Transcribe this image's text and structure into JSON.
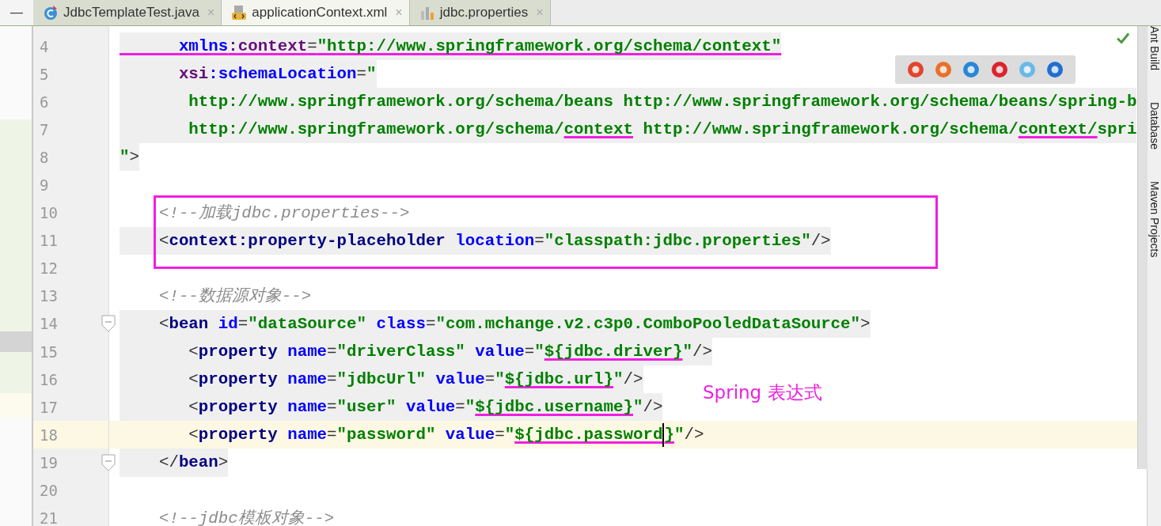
{
  "panel_button": "—",
  "tabs": [
    {
      "label": "JdbcTemplateTest.java",
      "kind": "java",
      "selected": false,
      "close": "×"
    },
    {
      "label": "applicationContext.xml",
      "kind": "xml",
      "selected": true,
      "close": "×"
    },
    {
      "label": "jdbc.properties",
      "kind": "properties",
      "selected": false,
      "close": "×"
    }
  ],
  "lines": [
    {
      "number": "4",
      "fold": false,
      "shaded": true,
      "boxed": false,
      "current": false,
      "tokens": [
        {
          "text": "      xmlns",
          "kind": "attr",
          "underlined": true
        },
        {
          "text": ":context",
          "kind": "ns",
          "underlined": true
        },
        {
          "text": "=",
          "kind": "punct",
          "underlined": true
        },
        {
          "text": "\"http://www.springframework.org/schema/context\"",
          "kind": "value",
          "underlined": true
        }
      ]
    },
    {
      "number": "5",
      "fold": false,
      "shaded": true,
      "boxed": false,
      "current": false,
      "tokens": [
        {
          "text": "      xsi",
          "kind": "ns",
          "underlined": false
        },
        {
          "text": ":schemaLocation",
          "kind": "attr",
          "underlined": false
        },
        {
          "text": "=",
          "kind": "punct",
          "underlined": false
        },
        {
          "text": "\"",
          "kind": "value",
          "underlined": false
        }
      ]
    },
    {
      "number": "6",
      "fold": false,
      "shaded": true,
      "boxed": false,
      "current": false,
      "tokens": [
        {
          "text": "       http://www.springframework.org/schema/beans http://www.springframework.org/schema/beans/spring-b",
          "kind": "value",
          "underlined": false
        }
      ]
    },
    {
      "number": "7",
      "fold": false,
      "shaded": true,
      "boxed": false,
      "current": false,
      "tokens": [
        {
          "text": "       http://www.springframework.org/schema/",
          "kind": "value",
          "underlined": false
        },
        {
          "text": "context",
          "kind": "value",
          "underlined": true
        },
        {
          "text": " http://www.springframework.org/schema/",
          "kind": "value",
          "underlined": false
        },
        {
          "text": "context/",
          "kind": "value",
          "underlined": true
        },
        {
          "text": "spri",
          "kind": "value",
          "underlined": false
        }
      ]
    },
    {
      "number": "8",
      "fold": false,
      "shaded": true,
      "boxed": false,
      "current": false,
      "tokens": [
        {
          "text": "\"",
          "kind": "value",
          "underlined": false
        },
        {
          "text": ">",
          "kind": "punct",
          "underlined": false
        }
      ]
    },
    {
      "number": "9",
      "fold": false,
      "shaded": false,
      "boxed": false,
      "current": false
    },
    {
      "number": "10",
      "fold": false,
      "shaded": false,
      "boxed": true,
      "current": false,
      "tokens": [
        {
          "text": "    <!--加载jdbc.properties-->",
          "kind": "comment",
          "underlined": false
        }
      ]
    },
    {
      "number": "11",
      "fold": false,
      "shaded": true,
      "boxed": true,
      "current": false,
      "tokens": [
        {
          "text": "    <",
          "kind": "punct",
          "underlined": false
        },
        {
          "text": "context:property-placeholder",
          "kind": "tag",
          "underlined": false
        },
        {
          "text": " location",
          "kind": "attr",
          "underlined": false
        },
        {
          "text": "=",
          "kind": "punct",
          "underlined": false
        },
        {
          "text": "\"classpath:jdbc.properties\"",
          "kind": "value",
          "underlined": false
        },
        {
          "text": "/>",
          "kind": "punct",
          "underlined": false
        }
      ]
    },
    {
      "number": "12",
      "fold": false,
      "shaded": false,
      "boxed": true,
      "current": false
    },
    {
      "number": "13",
      "fold": false,
      "shaded": false,
      "boxed": false,
      "current": false,
      "tokens": [
        {
          "text": "    <!--数据源对象-->",
          "kind": "comment",
          "underlined": false
        }
      ]
    },
    {
      "number": "14",
      "fold": true,
      "shaded": true,
      "boxed": false,
      "current": false,
      "tokens": [
        {
          "text": "    <",
          "kind": "punct",
          "underlined": false
        },
        {
          "text": "bean",
          "kind": "tag",
          "underlined": false
        },
        {
          "text": " id",
          "kind": "attr",
          "underlined": false
        },
        {
          "text": "=",
          "kind": "punct",
          "underlined": false
        },
        {
          "text": "\"dataSource\"",
          "kind": "value",
          "underlined": false
        },
        {
          "text": " class",
          "kind": "attr",
          "underlined": false
        },
        {
          "text": "=",
          "kind": "punct",
          "underlined": false
        },
        {
          "text": "\"com.mchange.v2.c3p0.ComboPooledDataSource\"",
          "kind": "value",
          "underlined": false
        },
        {
          "text": ">",
          "kind": "punct",
          "underlined": false
        }
      ]
    },
    {
      "number": "15",
      "fold": false,
      "shaded": true,
      "boxed": false,
      "current": false,
      "tokens": [
        {
          "text": "       <",
          "kind": "punct",
          "underlined": false
        },
        {
          "text": "property",
          "kind": "tag",
          "underlined": false
        },
        {
          "text": " name",
          "kind": "attr",
          "underlined": false
        },
        {
          "text": "=",
          "kind": "punct",
          "underlined": false
        },
        {
          "text": "\"driverClass\"",
          "kind": "value",
          "underlined": false
        },
        {
          "text": " value",
          "kind": "attr",
          "underlined": false
        },
        {
          "text": "=",
          "kind": "punct",
          "underlined": false
        },
        {
          "text": "\"",
          "kind": "value",
          "underlined": false
        },
        {
          "text": "${jdbc.driver}",
          "kind": "value",
          "underlined": true
        },
        {
          "text": "\"",
          "kind": "value",
          "underlined": false
        },
        {
          "text": "/>",
          "kind": "punct",
          "underlined": false
        }
      ]
    },
    {
      "number": "16",
      "fold": false,
      "shaded": true,
      "boxed": false,
      "current": false,
      "tokens": [
        {
          "text": "       <",
          "kind": "punct",
          "underlined": false
        },
        {
          "text": "property",
          "kind": "tag",
          "underlined": false
        },
        {
          "text": " name",
          "kind": "attr",
          "underlined": false
        },
        {
          "text": "=",
          "kind": "punct",
          "underlined": false
        },
        {
          "text": "\"jdbcUrl\"",
          "kind": "value",
          "underlined": false
        },
        {
          "text": " value",
          "kind": "attr",
          "underlined": false
        },
        {
          "text": "=",
          "kind": "punct",
          "underlined": false
        },
        {
          "text": "\"",
          "kind": "value",
          "underlined": false
        },
        {
          "text": "${jdbc.url}",
          "kind": "value",
          "underlined": true
        },
        {
          "text": "\"",
          "kind": "value",
          "underlined": false
        },
        {
          "text": "/>",
          "kind": "punct",
          "underlined": false
        }
      ]
    },
    {
      "number": "17",
      "fold": false,
      "shaded": true,
      "boxed": false,
      "current": false,
      "tokens": [
        {
          "text": "       <",
          "kind": "punct",
          "underlined": false
        },
        {
          "text": "property",
          "kind": "tag",
          "underlined": false
        },
        {
          "text": " name",
          "kind": "attr",
          "underlined": false
        },
        {
          "text": "=",
          "kind": "punct",
          "underlined": false
        },
        {
          "text": "\"user\"",
          "kind": "value",
          "underlined": false
        },
        {
          "text": " value",
          "kind": "attr",
          "underlined": false
        },
        {
          "text": "=",
          "kind": "punct",
          "underlined": false
        },
        {
          "text": "\"",
          "kind": "value",
          "underlined": false
        },
        {
          "text": "${jdbc.username}",
          "kind": "value",
          "underlined": true
        },
        {
          "text": "\"",
          "kind": "value",
          "underlined": false
        },
        {
          "text": "/>",
          "kind": "punct",
          "underlined": false
        }
      ]
    },
    {
      "number": "18",
      "fold": false,
      "shaded": false,
      "boxed": false,
      "current": true,
      "tokens": [
        {
          "text": "       <",
          "kind": "punct",
          "underlined": false
        },
        {
          "text": "property",
          "kind": "tag",
          "underlined": false
        },
        {
          "text": " name",
          "kind": "attr",
          "underlined": false
        },
        {
          "text": "=",
          "kind": "punct",
          "underlined": false
        },
        {
          "text": "\"password\"",
          "kind": "value",
          "underlined": false
        },
        {
          "text": " value",
          "kind": "attr",
          "underlined": false
        },
        {
          "text": "=",
          "kind": "punct",
          "underlined": false
        },
        {
          "text": "\"",
          "kind": "value",
          "underlined": false
        },
        {
          "text": "${jdbc.password",
          "kind": "value",
          "underlined": true
        },
        {
          "kind": "caret"
        },
        {
          "text": "}",
          "kind": "value",
          "underlined": true
        },
        {
          "text": "\"",
          "kind": "value",
          "underlined": false
        },
        {
          "text": "/>",
          "kind": "punct",
          "underlined": false
        }
      ]
    },
    {
      "number": "19",
      "fold": true,
      "shaded": true,
      "boxed": false,
      "current": false,
      "tokens": [
        {
          "text": "    </",
          "kind": "punct",
          "underlined": false
        },
        {
          "text": "bean",
          "kind": "tag",
          "underlined": false
        },
        {
          "text": ">",
          "kind": "punct",
          "underlined": false
        }
      ]
    },
    {
      "number": "20",
      "fold": false,
      "shaded": false,
      "boxed": false,
      "current": false
    },
    {
      "number": "21",
      "fold": false,
      "shaded": false,
      "boxed": false,
      "current": false,
      "tokens": [
        {
          "text": "    <!--jdbc模板对象-->",
          "kind": "comment",
          "underlined": false
        }
      ]
    }
  ],
  "annotation": "Spring 表达式",
  "tool_windows": [
    "Ant Build",
    "Database",
    "Maven Projects"
  ]
}
